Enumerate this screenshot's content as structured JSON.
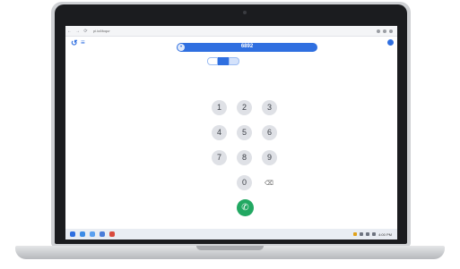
{
  "browser": {
    "url": "pi.iu6foqur",
    "nav": [
      "←",
      "→",
      "⟳"
    ]
  },
  "app": {
    "logo_icon": "back-arrow-icon",
    "menu_icon": "hamburger-menu-icon",
    "menu_glyph": "≡",
    "logo_glyph": "↺"
  },
  "dialer": {
    "number": "6892",
    "tabs": [
      "",
      "",
      ""
    ],
    "keys": [
      "1",
      "2",
      "3",
      "4",
      "5",
      "6",
      "7",
      "8",
      "9",
      "0"
    ],
    "backspace_glyph": "⌫",
    "call_glyph": "✆"
  },
  "taskbar": {
    "time": "4:00 PM"
  },
  "colors": {
    "accent": "#2f6fe0",
    "call": "#22a862"
  }
}
